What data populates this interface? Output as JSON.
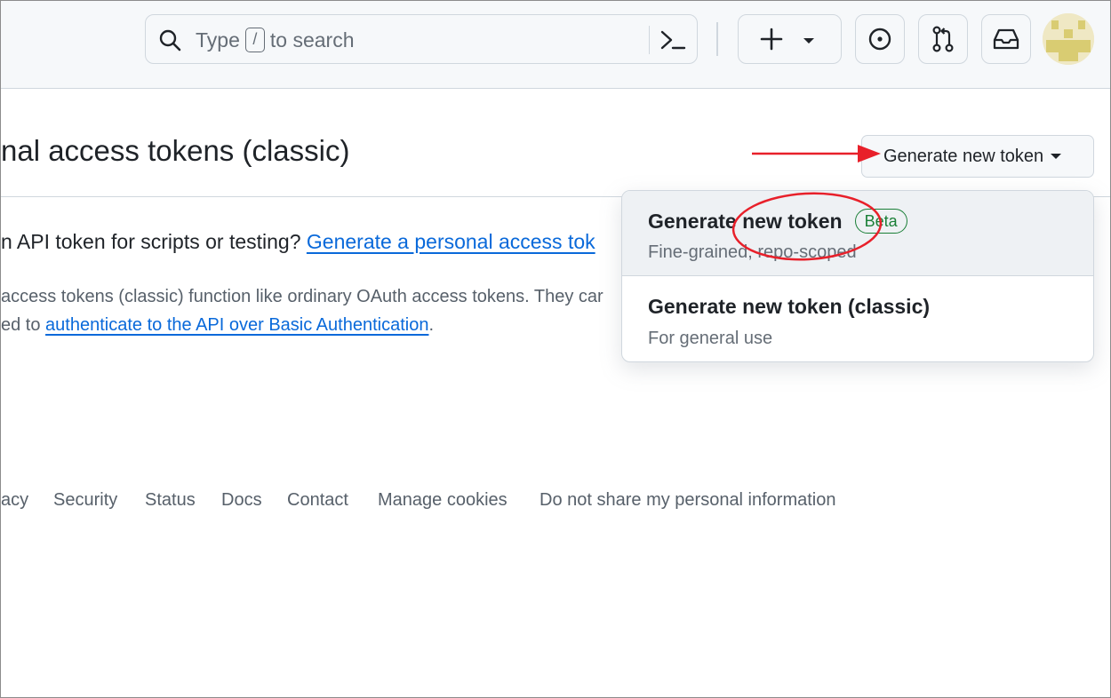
{
  "header": {
    "search_prefix": "Type",
    "search_key": "/",
    "search_suffix": "to search"
  },
  "page": {
    "title": "nal access tokens (classic)",
    "generate_button": "Generate new token",
    "intro_text": "n API token for scripts or testing?",
    "intro_link": "Generate a personal access tok",
    "desc_line1": "access tokens (classic) function like ordinary OAuth access tokens. They car",
    "desc_line2_prefix": "ed to",
    "desc_line2_link": "authenticate to the API over Basic Authentication",
    "desc_line2_suffix": "."
  },
  "menu": {
    "items": [
      {
        "title": "Generate new token",
        "badge": "Beta",
        "subtitle": "Fine-grained, repo-scoped"
      },
      {
        "title": "Generate new token (classic)",
        "subtitle": "For general use"
      }
    ]
  },
  "footer": {
    "links": [
      "acy",
      "Security",
      "Status",
      "Docs",
      "Contact",
      "Manage cookies",
      "Do not share my personal information"
    ]
  },
  "colors": {
    "link": "#0969da",
    "annotation_red": "#e8202a",
    "badge_green": "#1a7f37"
  }
}
